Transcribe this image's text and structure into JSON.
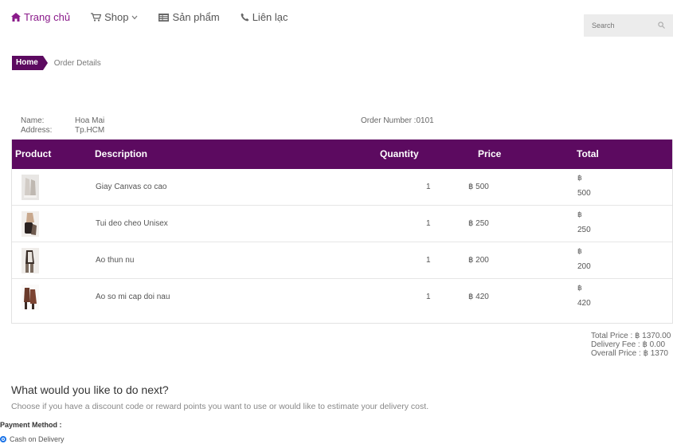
{
  "nav": {
    "items": [
      {
        "label": "Trang chủ",
        "icon": "home-icon",
        "active": true
      },
      {
        "label": "Shop",
        "icon": "cart-icon"
      },
      {
        "label": "Sản phẩm",
        "icon": "list-icon"
      },
      {
        "label": "Liên lạc",
        "icon": "phone-icon"
      }
    ]
  },
  "search": {
    "placeholder": "Search"
  },
  "breadcrumb": {
    "home": "Home",
    "current": "Order Details"
  },
  "customer": {
    "name_label": "Name:",
    "name": "Hoa Mai",
    "address_label": "Address:",
    "address": "Tp.HCM",
    "order_number": "Order Number :0101"
  },
  "table": {
    "headers": {
      "product": "Product",
      "description": "Description",
      "quantity": "Quantity",
      "price": "Price",
      "total": "Total"
    },
    "rows": [
      {
        "description": "Giay Canvas co cao",
        "quantity": "1",
        "price": "฿ 500",
        "total_symbol": "฿",
        "total": "500"
      },
      {
        "description": "Tui deo cheo Unisex",
        "quantity": "1",
        "price": "฿ 250",
        "total_symbol": "฿",
        "total": "250"
      },
      {
        "description": "Ao thun nu",
        "quantity": "1",
        "price": "฿ 200",
        "total_symbol": "฿",
        "total": "200"
      },
      {
        "description": "Ao so mi cap doi nau",
        "quantity": "1",
        "price": "฿ 420",
        "total_symbol": "฿",
        "total": "420"
      }
    ]
  },
  "summary": {
    "total_price": "Total Price : ฿ 1370.00",
    "delivery_fee": "Delivery Fee : ฿ 0.00",
    "overall_price": "Overall Price : ฿ 1370"
  },
  "next": {
    "title": "What would you like to do next?",
    "description": "Choose if you have a discount code or reward points you want to use or would like to estimate your delivery cost."
  },
  "payment": {
    "label": "Payment Method :",
    "option": "Cash on Delivery"
  },
  "colors": {
    "brand": "#5c0a60",
    "accent": "#8a1a8a",
    "radio": "#1a73e8"
  }
}
